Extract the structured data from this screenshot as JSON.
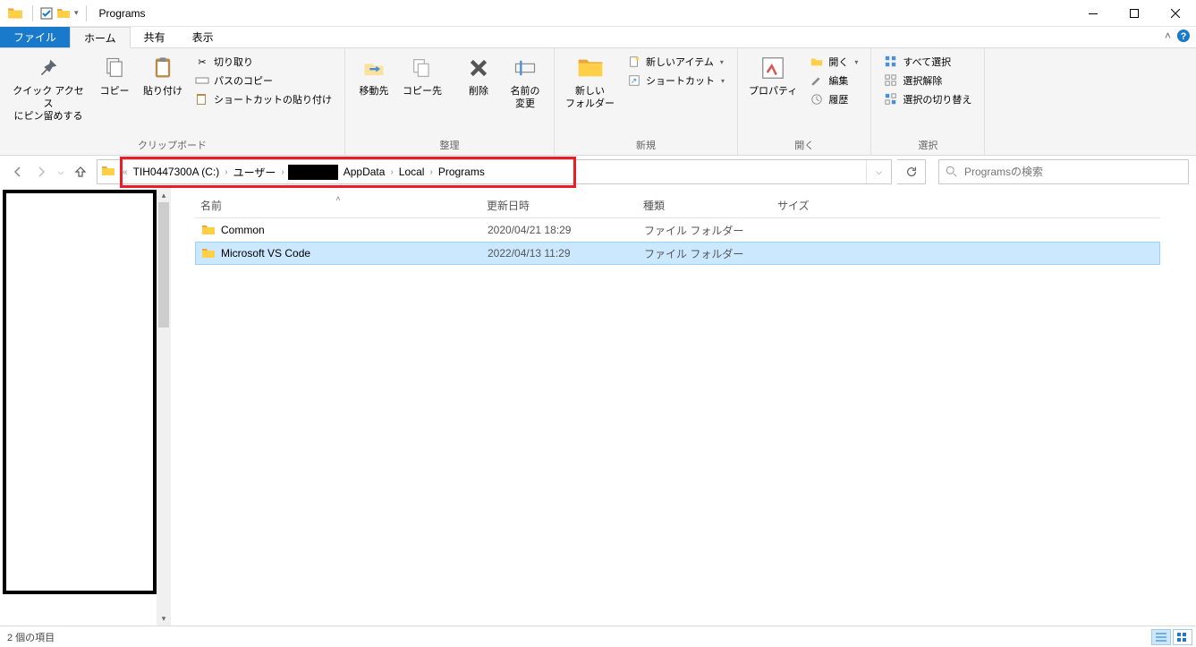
{
  "window": {
    "title": "Programs"
  },
  "tabs": {
    "file": "ファイル",
    "home": "ホーム",
    "share": "共有",
    "view": "表示"
  },
  "ribbon": {
    "clipboard": {
      "pin": "クイック アクセス\nにピン留めする",
      "copy": "コピー",
      "paste": "貼り付け",
      "cut": "切り取り",
      "copypath": "パスのコピー",
      "pasteshortcut": "ショートカットの貼り付け",
      "label": "クリップボード"
    },
    "organize": {
      "moveto": "移動先",
      "copyto": "コピー先",
      "delete": "削除",
      "rename": "名前の\n変更",
      "label": "整理"
    },
    "new": {
      "newfolder": "新しい\nフォルダー",
      "newitem": "新しいアイテム",
      "shortcut": "ショートカット",
      "label": "新規"
    },
    "open": {
      "properties": "プロパティ",
      "open": "開く",
      "edit": "編集",
      "history": "履歴",
      "label": "開く"
    },
    "select": {
      "selectall": "すべて選択",
      "selectnone": "選択解除",
      "invert": "選択の切り替え",
      "label": "選択"
    }
  },
  "breadcrumb": {
    "parts": [
      "TIH0447300A (C:)",
      "ユーザー",
      "",
      "AppData",
      "Local",
      "Programs"
    ]
  },
  "search": {
    "placeholder": "Programsの検索"
  },
  "columns": {
    "name": "名前",
    "date": "更新日時",
    "type": "種類",
    "size": "サイズ"
  },
  "rows": [
    {
      "name": "Common",
      "date": "2020/04/21 18:29",
      "type": "ファイル フォルダー"
    },
    {
      "name": "Microsoft VS Code",
      "date": "2022/04/13 11:29",
      "type": "ファイル フォルダー"
    }
  ],
  "status": {
    "items": "2 個の項目"
  }
}
